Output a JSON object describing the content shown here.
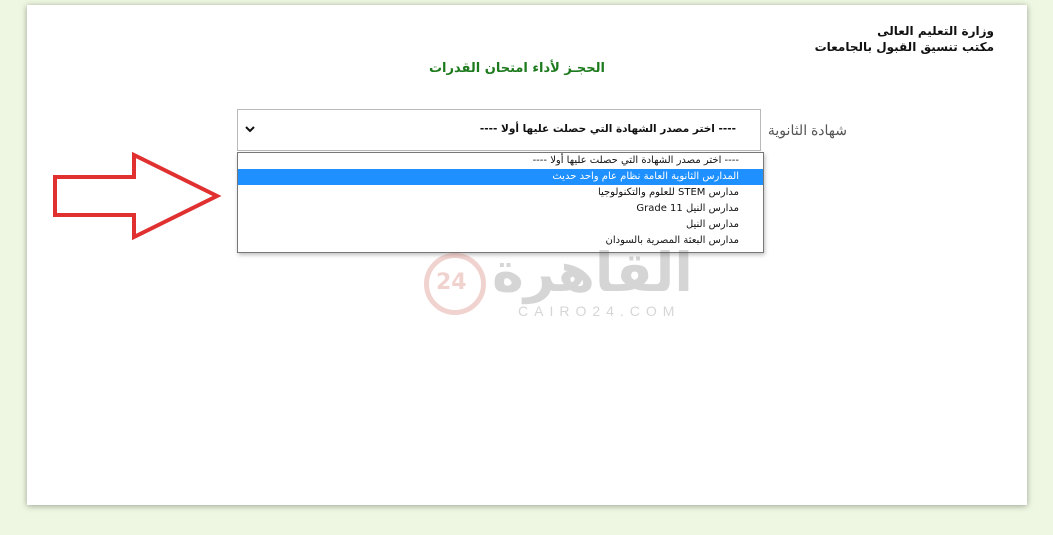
{
  "header": {
    "ministry_line1": "وزارة التعليم العالى",
    "ministry_line2": "مكتب تنسيق القبول بالجامعات"
  },
  "page_title": "الحجـز لأداء امتحان القدرات",
  "form": {
    "certificate_label": "شهادة الثانوية",
    "select_value": "---- اختر مصدر الشهادة التي حصلت عليها أولا ----",
    "options": [
      "---- اختر مصدر الشهادة التي حصلت عليها أولا ----",
      "المدارس الثانوية العامة نظام عام واحد حديث",
      "مدارس STEM للعلوم والتكنولوجيا",
      "مدارس النيل Grade 11",
      "مدارس النيل",
      "مدارس البعثة المصرية بالسودان"
    ],
    "selected_index": 1
  },
  "watermark": {
    "number": "24",
    "word": "القاهرة",
    "domain": "CAIRO24.COM"
  },
  "colors": {
    "title_green": "#1d7a1d",
    "arrow_red": "#e03030",
    "highlight_blue": "#1e90ff",
    "background": "#eef7e2"
  }
}
